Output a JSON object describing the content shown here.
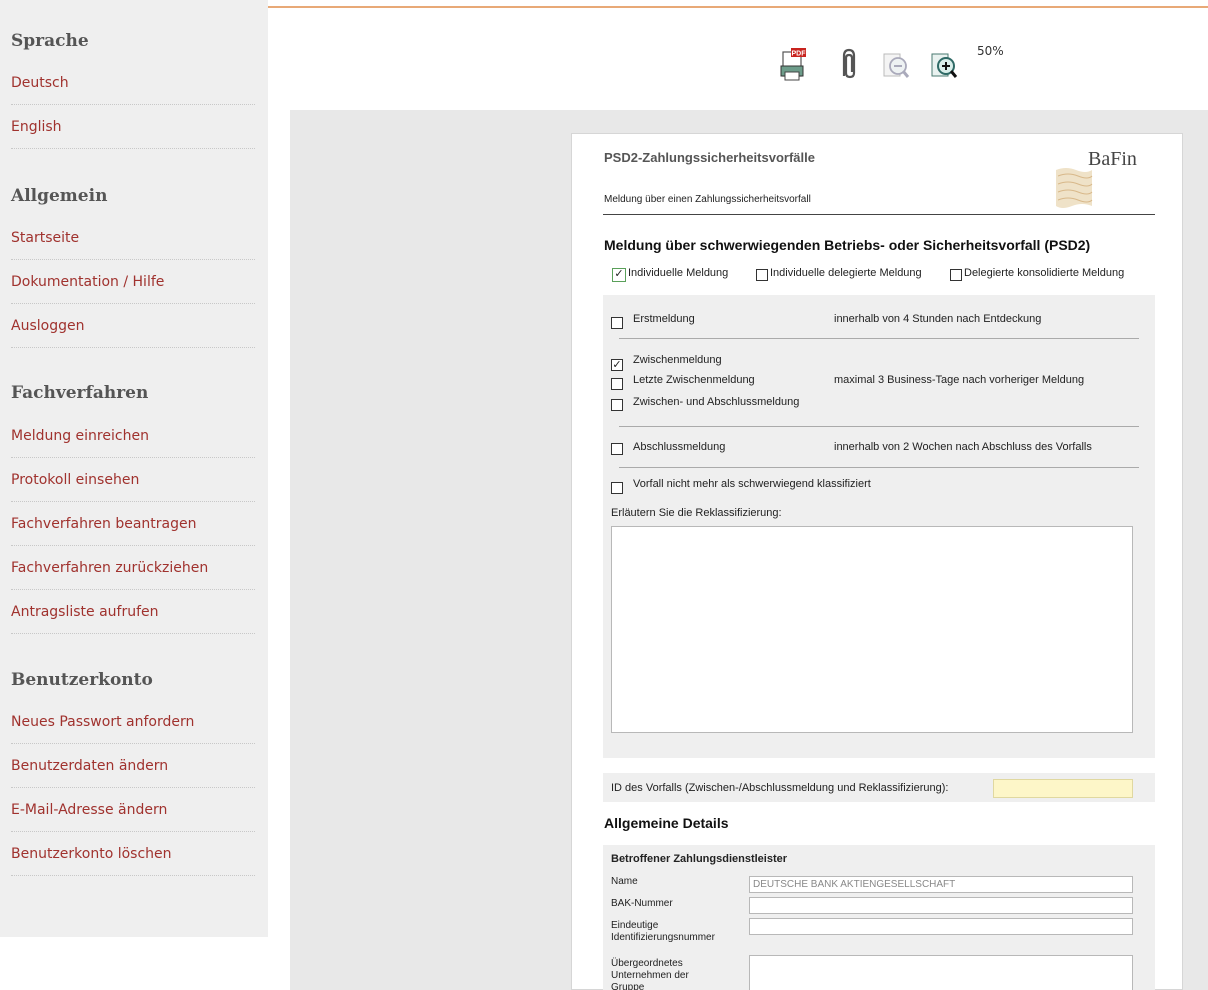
{
  "sidebar": {
    "sections": [
      {
        "title": "Sprache",
        "items": [
          "Deutsch",
          "English"
        ]
      },
      {
        "title": "Allgemein",
        "items": [
          "Startseite",
          "Dokumentation / Hilfe",
          "Ausloggen"
        ]
      },
      {
        "title": "Fachverfahren",
        "items": [
          "Meldung einreichen",
          "Protokoll einsehen",
          "Fachverfahren beantragen",
          "Fachverfahren zurückziehen",
          "Antragsliste aufrufen"
        ]
      },
      {
        "title": "Benutzerkonto",
        "items": [
          "Neues Passwort anfordern",
          "Benutzerdaten ändern",
          "E-Mail-Adresse ändern",
          "Benutzerkonto löschen"
        ]
      }
    ]
  },
  "toolbar": {
    "pdf_badge": "PDF",
    "zoom": "50%",
    "icons": [
      "pdf-export-icon",
      "attachment-icon",
      "zoom-out-icon",
      "zoom-in-icon"
    ]
  },
  "document": {
    "title": "PSD2-Zahlungssicherheitsvorfälle",
    "subtitle": "Meldung über einen Zahlungssicherheitsvorfall",
    "logo_text": "BaFin",
    "heading": "Meldung über schwerwiegenden Betriebs- oder Sicherheitsvorfall (PSD2)",
    "report_types": [
      {
        "label": "Individuelle Meldung",
        "checked": true
      },
      {
        "label": "Individuelle delegierte Meldung",
        "checked": false
      },
      {
        "label": "Delegierte konsolidierte Meldung",
        "checked": false
      }
    ],
    "erstmeldung": {
      "label": "Erstmeldung",
      "checked": false,
      "note": "innerhalb von 4 Stunden nach Entdeckung"
    },
    "zwischen": [
      {
        "label": "Zwischenmeldung",
        "checked": true
      },
      {
        "label": "Letzte Zwischenmeldung",
        "checked": false
      },
      {
        "label": "Zwischen- und Abschlussmeldung",
        "checked": false
      }
    ],
    "zwischen_note": "maximal 3 Business-Tage nach vorheriger Meldung",
    "abschluss": {
      "label": "Abschlussmeldung",
      "checked": false,
      "note": "innerhalb von 2 Wochen nach Abschluss des Vorfalls"
    },
    "reclass": {
      "label": "Vorfall nicht mehr als schwerwiegend klassifiziert",
      "checked": false
    },
    "reclass_explain": "Erläutern Sie die Reklassifizierung:",
    "incident_id_label": "ID des Vorfalls (Zwischen-/Abschlussmeldung und Reklassifizierung):",
    "details_heading": "Allgemeine Details",
    "provider_heading": "Betroffener Zahlungsdienstleister",
    "fields": [
      {
        "label": "Name",
        "value": "DEUTSCHE BANK AKTIENGESELLSCHAFT"
      },
      {
        "label": "BAK-Nummer",
        "value": ""
      },
      {
        "label": "Eindeutige Identifizierungsnummer",
        "value": ""
      },
      {
        "label": "Übergeordnetes Unternehmen der Gruppe",
        "value": ""
      }
    ]
  },
  "colors": {
    "link": "#a0322e",
    "sidebar_bg": "#efefef",
    "accent_line": "#e8a977",
    "id_field_bg": "#fdf6c8"
  }
}
